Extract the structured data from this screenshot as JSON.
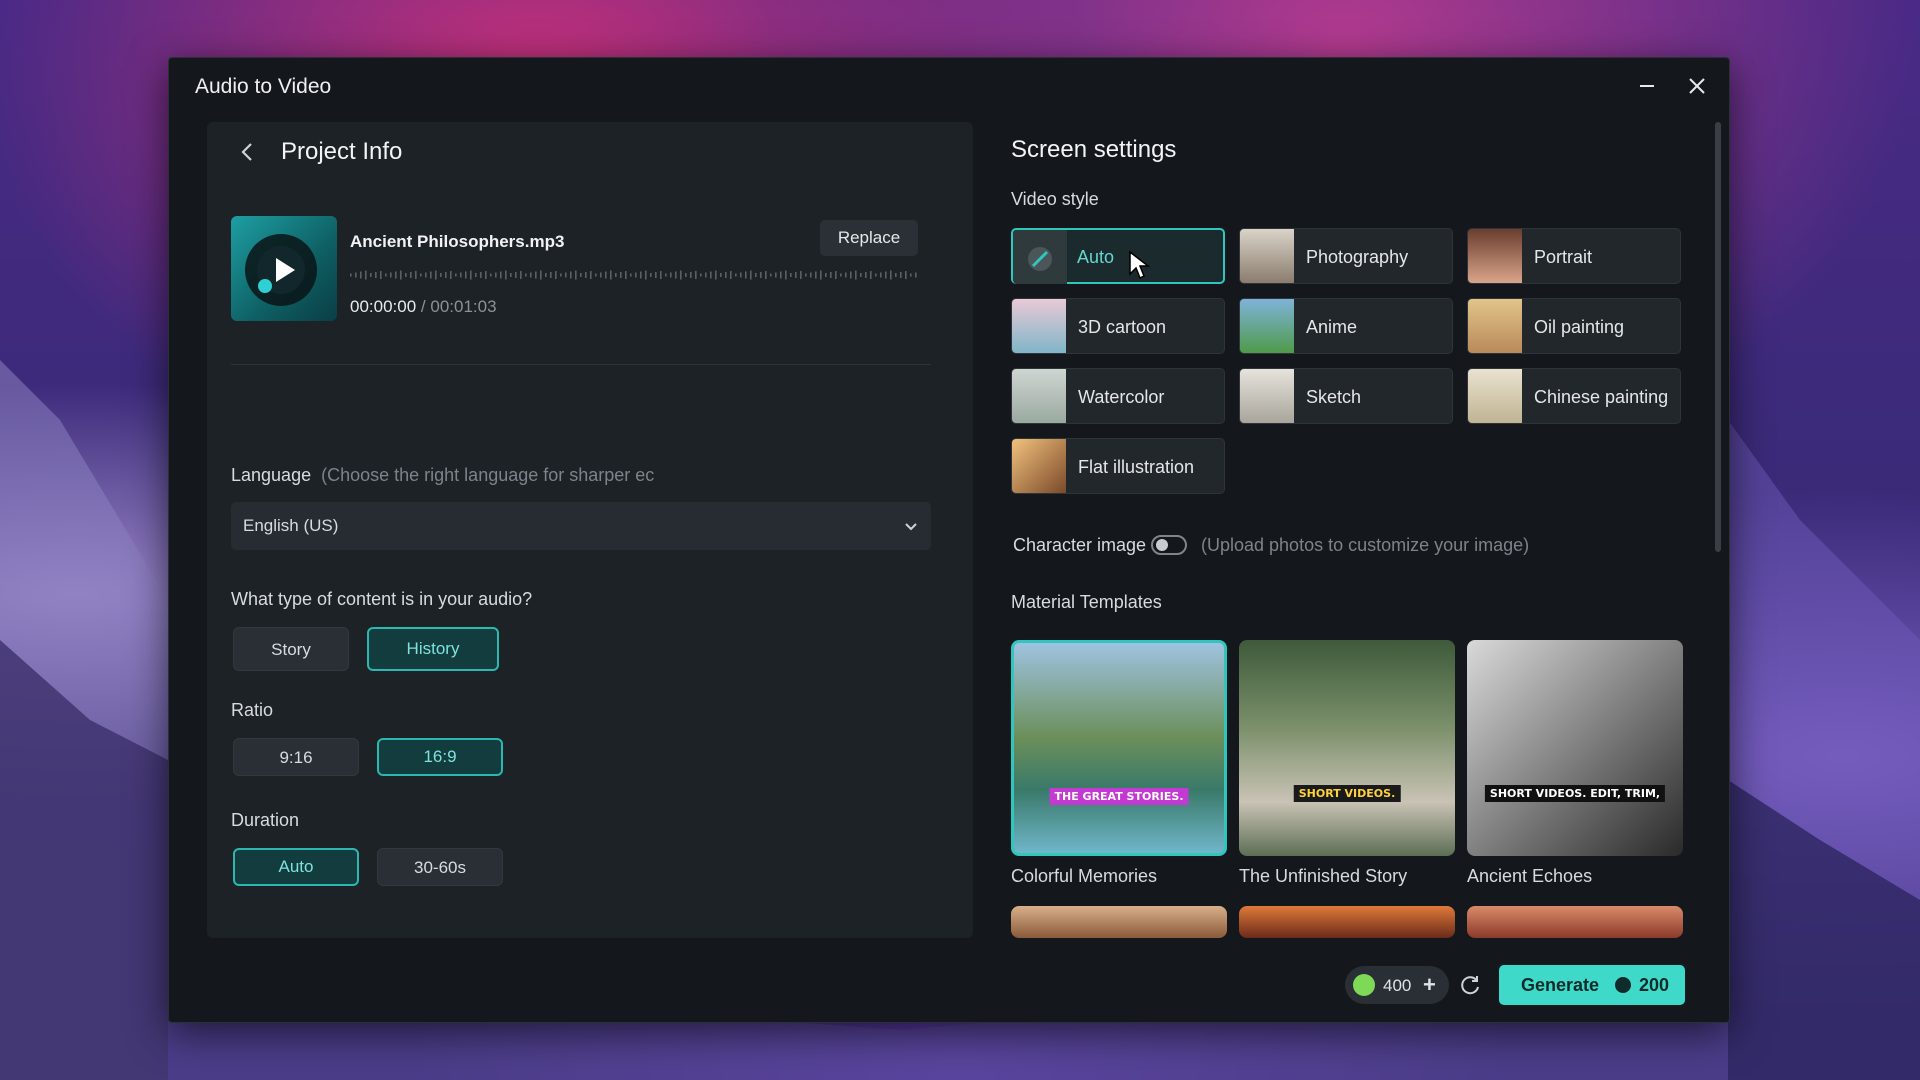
{
  "window": {
    "title": "Audio to Video"
  },
  "project": {
    "heading": "Project Info",
    "file_name": "Ancient Philosophers.mp3",
    "replace_label": "Replace",
    "time_current": "00:00:00",
    "time_sep": "/",
    "time_total": "00:01:03"
  },
  "language": {
    "label": "Language",
    "hint": "(Choose the right language for sharper ec",
    "value": "English (US)"
  },
  "content_type": {
    "question": "What type of content is in your audio?",
    "options": [
      "Story",
      "History"
    ],
    "selected": "History"
  },
  "ratio": {
    "label": "Ratio",
    "options": [
      "9:16",
      "16:9"
    ],
    "selected": "16:9"
  },
  "duration": {
    "label": "Duration",
    "options": [
      "Auto",
      "30-60s"
    ],
    "selected": "Auto"
  },
  "screen": {
    "heading": "Screen settings",
    "video_style_label": "Video style",
    "styles": [
      "Auto",
      "Photography",
      "Portrait",
      "3D cartoon",
      "Anime",
      "Oil painting",
      "Watercolor",
      "Sketch",
      "Chinese painting",
      "Flat illustration"
    ],
    "selected_style": "Auto",
    "character_label": "Character image",
    "character_hint": "(Upload photos to customize your image)",
    "templates_label": "Material Templates",
    "templates": [
      {
        "name": "Colorful Memories",
        "caption": "THE GREAT STORIES."
      },
      {
        "name": "The Unfinished Story",
        "caption": "SHORT VIDEOS."
      },
      {
        "name": "Ancient Echoes",
        "caption": "SHORT VIDEOS. EDIT, TRIM,"
      }
    ]
  },
  "footer": {
    "credits": "400",
    "generate_label": "Generate",
    "generate_cost": "200"
  },
  "colors": {
    "accent": "#3fd9c9",
    "selected_border": "#31c6bd",
    "panel": "#1d2227",
    "window": "#14181d"
  },
  "icons": [
    "back-arrow-icon",
    "minimize-icon",
    "close-icon",
    "chevron-down-icon",
    "refresh-icon",
    "coin-icon",
    "plus-icon",
    "play-icon"
  ]
}
